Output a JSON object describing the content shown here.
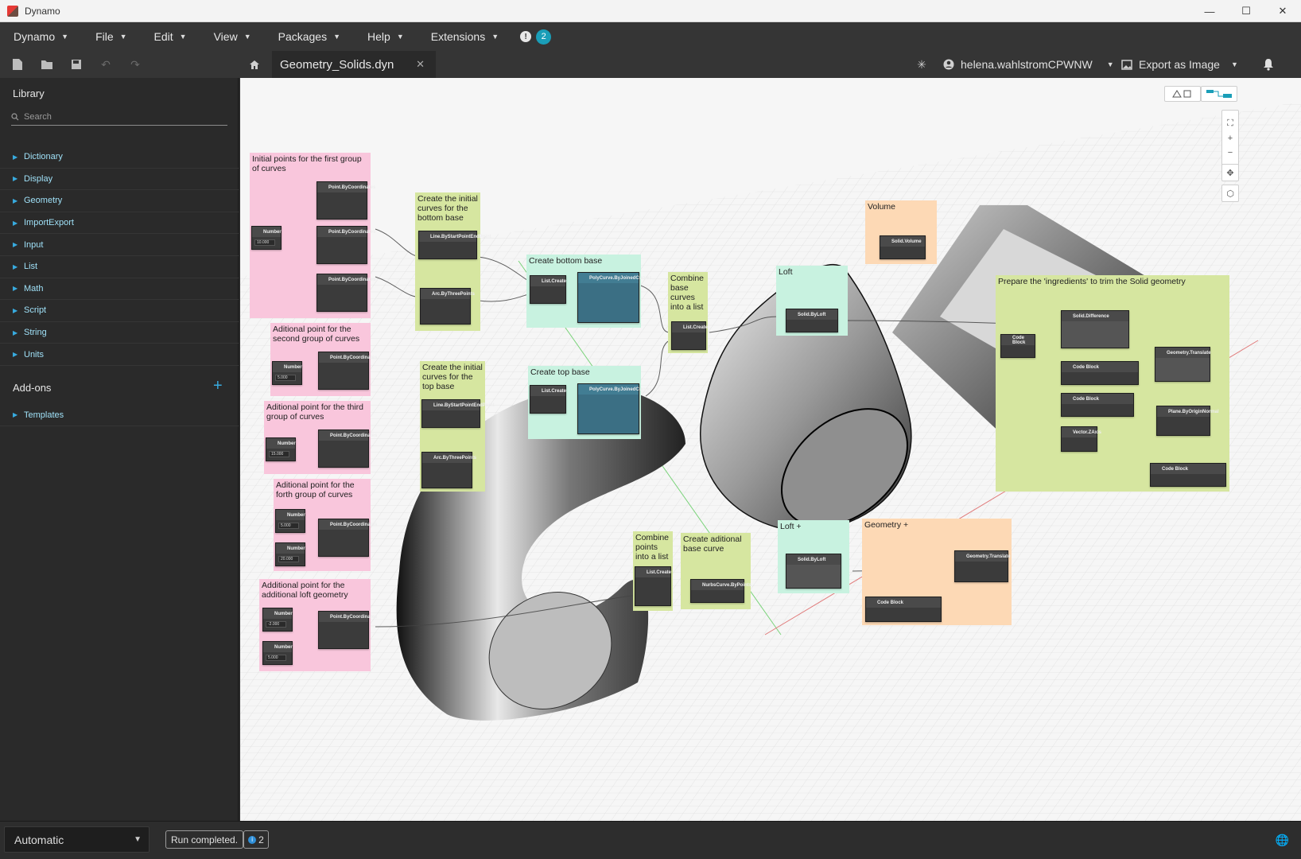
{
  "window": {
    "title": "Dynamo",
    "controls": [
      "—",
      "☐",
      "✕"
    ]
  },
  "menu": {
    "items": [
      "Dynamo",
      "File",
      "Edit",
      "View",
      "Packages",
      "Help",
      "Extensions"
    ],
    "notification_count": "2"
  },
  "toolbar": {
    "tab_label": "Geometry_Solids.dyn",
    "user_name": "helena.wahlstromCPWNW",
    "export_label": "Export as Image"
  },
  "library": {
    "title": "Library",
    "search_placeholder": "Search",
    "items": [
      "Dictionary",
      "Display",
      "Geometry",
      "ImportExport",
      "Input",
      "List",
      "Math",
      "Script",
      "String",
      "Units"
    ],
    "addons_title": "Add-ons",
    "addons_items": [
      "Templates"
    ]
  },
  "canvas": {
    "groups": [
      {
        "id": "g1",
        "title": "Initial points for the first group of curves",
        "color": "#f9c6dc"
      },
      {
        "id": "g2",
        "title": "Aditional point for the second group of curves",
        "color": "#f9c6dc"
      },
      {
        "id": "g3",
        "title": "Aditional point for the third group of curves",
        "color": "#f9c6dc"
      },
      {
        "id": "g4",
        "title": "Aditional point for the forth group of curves",
        "color": "#f9c6dc"
      },
      {
        "id": "g5",
        "title": "Additional point for the additional loft geometry",
        "color": "#f9c6dc"
      },
      {
        "id": "g6",
        "title": "Create the initial curves for the bottom base",
        "color": "#d6e6a0"
      },
      {
        "id": "g7",
        "title": "Create the initial curves for the top base",
        "color": "#d6e6a0"
      },
      {
        "id": "g8",
        "title": "Create bottom base",
        "color": "#c8f2e0"
      },
      {
        "id": "g9",
        "title": "Create top base",
        "color": "#c8f2e0"
      },
      {
        "id": "g10",
        "title": "Combine base curves into a list",
        "color": "#d6e6a0"
      },
      {
        "id": "g11",
        "title": "Loft",
        "color": "#c8f2e0"
      },
      {
        "id": "g12",
        "title": "Volume",
        "color": "#fdd9b5"
      },
      {
        "id": "g13",
        "title": "Prepare the 'ingredients' to trim the Solid geometry",
        "color": "#d6e6a0"
      },
      {
        "id": "g14",
        "title": "Combine points into a list",
        "color": "#d6e6a0"
      },
      {
        "id": "g15",
        "title": "Create aditional base curve",
        "color": "#d6e6a0"
      },
      {
        "id": "g16",
        "title": "Loft +",
        "color": "#c8f2e0"
      },
      {
        "id": "g17",
        "title": "Geometry +",
        "color": "#fdd9b5"
      }
    ],
    "node_labels": {
      "number": "Number",
      "point_by_coord": "Point.ByCoordinates",
      "line": "Line.ByStartPointEndPoint",
      "arc": "Arc.ByThreePoints",
      "list_create": "List.Create",
      "polycurve": "PolyCurve.ByJoinedCurves",
      "solid_loft": "Solid.ByLoft",
      "solid_volume": "Solid.Volume",
      "code_block": "Code Block",
      "nurbs": "NurbsCurve.ByPoints",
      "geom_translate": "Geometry.Translate",
      "solid_difference": "Solid.Difference",
      "plane_by_origin": "Plane.ByOriginNormal",
      "vector_zaxis": "Vector.ZAxis"
    },
    "number_values": [
      "10.000",
      "5.000",
      "15.000",
      "5.000",
      "20.000",
      "-2.000",
      "5.000"
    ]
  },
  "status": {
    "run_mode": "Automatic",
    "run_status": "Run completed.",
    "notif_count": "2"
  }
}
